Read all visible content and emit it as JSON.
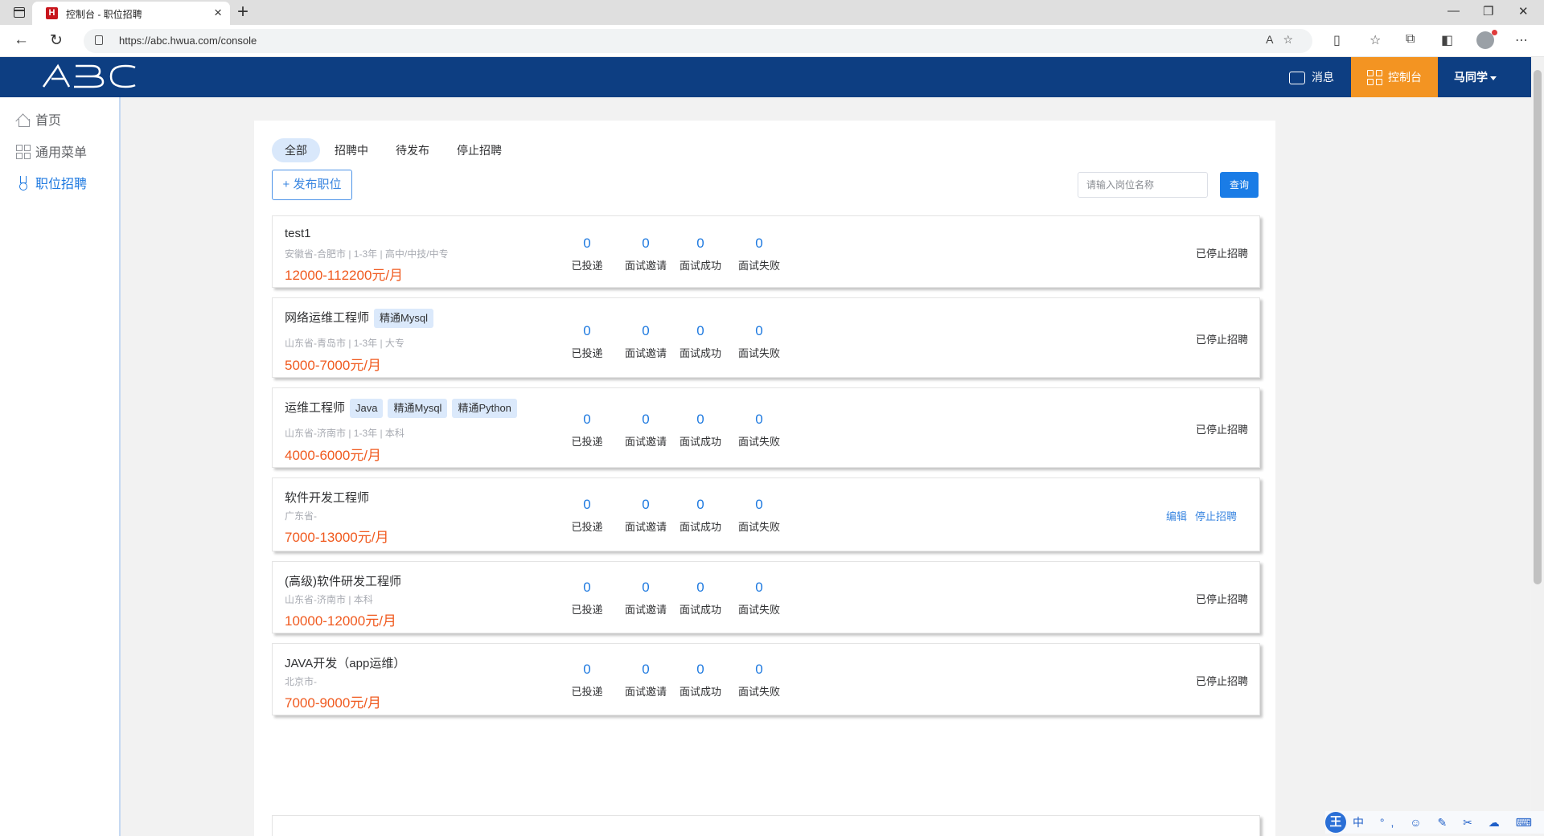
{
  "browser": {
    "tab_title": "控制台 - 职位招聘",
    "favicon_letter": "H",
    "url": "https://abc.hwua.com/console"
  },
  "header": {
    "logo_text": "ABC",
    "messages_label": "消息",
    "console_label": "控制台",
    "user_name": "马同学",
    "bg_color": "#0d3e82",
    "accent_color": "#f39422"
  },
  "sidebar": {
    "items": [
      {
        "label": "首页",
        "icon": "home-icon"
      },
      {
        "label": "通用菜单",
        "icon": "grid-icon"
      },
      {
        "label": "职位招聘",
        "icon": "job-icon"
      }
    ]
  },
  "filters": {
    "tabs": [
      "全部",
      "招聘中",
      "待发布",
      "停止招聘"
    ],
    "active": "全部"
  },
  "toolbar": {
    "publish_label": "+ 发布职位",
    "search_placeholder": "请输入岗位名称",
    "search_button": "查询"
  },
  "stat_labels": [
    "已投递",
    "面试邀请",
    "面试成功",
    "面试失败"
  ],
  "jobs": [
    {
      "title": "test1",
      "tags": [],
      "meta": "安徽省-合肥市 | 1-3年 | 高中/中技/中专",
      "salary": "12000-112200元/月",
      "stats": [
        "0",
        "0",
        "0",
        "0"
      ],
      "status": "已停止招聘"
    },
    {
      "title": "网络运维工程师",
      "tags": [
        "精通Mysql"
      ],
      "meta": "山东省-青岛市 | 1-3年 | 大专",
      "salary": "5000-7000元/月",
      "stats": [
        "0",
        "0",
        "0",
        "0"
      ],
      "status": "已停止招聘"
    },
    {
      "title": "运维工程师",
      "tags": [
        "Java",
        "精通Mysql",
        "精通Python"
      ],
      "meta": "山东省-济南市 | 1-3年 | 本科",
      "salary": "4000-6000元/月",
      "stats": [
        "0",
        "0",
        "0",
        "0"
      ],
      "status": "已停止招聘"
    },
    {
      "title": "软件开发工程师",
      "tags": [],
      "meta": "广东省-",
      "salary": "7000-13000元/月",
      "stats": [
        "0",
        "0",
        "0",
        "0"
      ],
      "actions": [
        "编辑",
        "停止招聘"
      ]
    },
    {
      "title": "(高级)软件研发工程师",
      "tags": [],
      "meta": "山东省-济南市 | 本科",
      "salary": "10000-12000元/月",
      "stats": [
        "0",
        "0",
        "0",
        "0"
      ],
      "status": "已停止招聘"
    },
    {
      "title": "JAVA开发（app运维）",
      "tags": [],
      "meta": "北京市-",
      "salary": "7000-9000元/月",
      "stats": [
        "0",
        "0",
        "0",
        "0"
      ],
      "status": "已停止招聘"
    }
  ],
  "ime": {
    "logo": "王",
    "items": "中 °, ☺ ✎ ✂ ☁ ⌨ ♙ ♞ ⚙"
  }
}
